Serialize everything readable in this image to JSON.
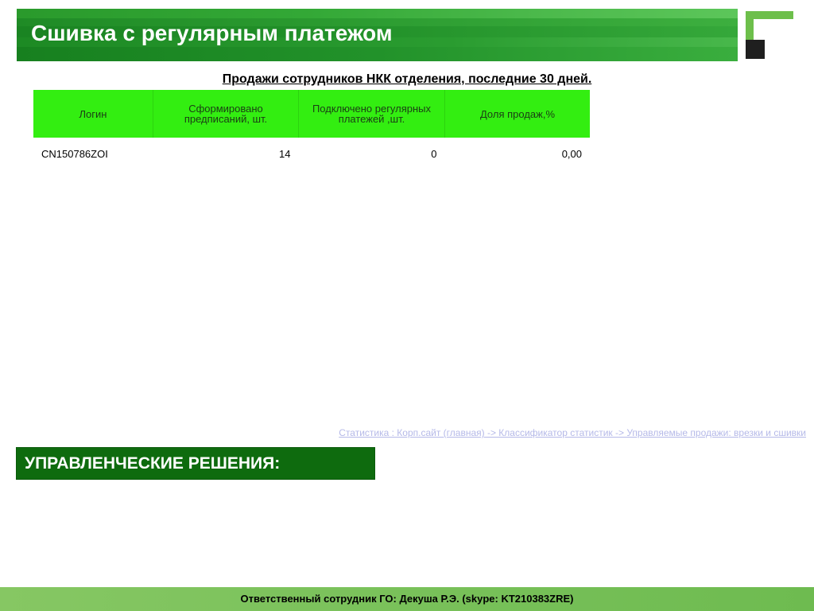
{
  "header": {
    "title": "Сшивка с регулярным платежом"
  },
  "logo": {
    "icon": "bank-logo-icon",
    "colors": {
      "frame": "#6dbf4b",
      "square": "#1f1f1f"
    }
  },
  "report": {
    "subtitle": "Продажи сотрудников НКК отделения, последние 30 дней.",
    "columns": [
      "Логин",
      "Сформировано предписаний, шт.",
      "Подключено регулярных платежей ,шт.",
      "Доля продаж,%"
    ],
    "rows": [
      {
        "login": "CN150786ZOI",
        "orders": "14",
        "connected": "0",
        "share": "0,00"
      }
    ]
  },
  "source_link": "Статистика : Корп.сайт (главная) -> Классификатор статистик -> Управляемые продажи: врезки и сшивки",
  "decisions": {
    "title": "УПРАВЛЕНЧЕСКИЕ РЕШЕНИЯ:"
  },
  "footer": {
    "text": "Ответственный сотрудник ГО: Декуша Р.Э. (skype: KT210383ZRE)"
  },
  "colors": {
    "header_green": "#1e8f25",
    "table_header": "#33ee11",
    "decisions_green": "#0e6b0e",
    "footer_green": "#79c15a",
    "share_value": "#007a00",
    "link": "#b5b9e8"
  }
}
